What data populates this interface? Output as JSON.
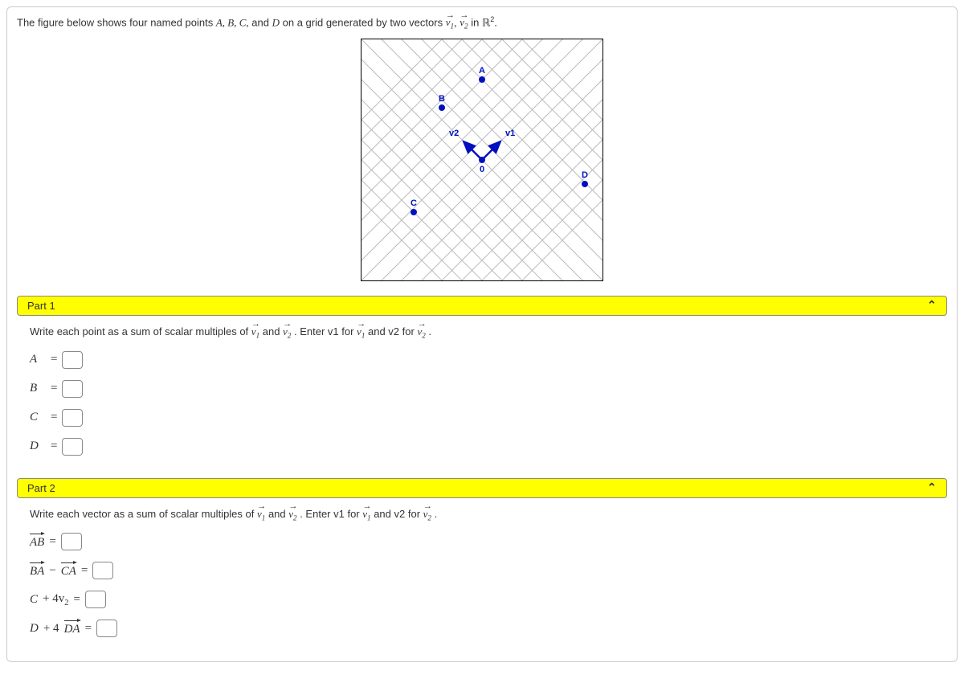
{
  "prompt": {
    "prefix": "The figure below shows four named points ",
    "pts": "A, B, C,",
    "and": " and ",
    "lastpt": "D",
    "mid": " on a grid generated by two vectors ",
    "inspace": " in ",
    "space": "ℝ",
    "exp": "2",
    "period": "."
  },
  "vecsub": {
    "one": "1",
    "two": "2"
  },
  "figure": {
    "labels": {
      "A": "A",
      "B": "B",
      "C": "C",
      "D": "D",
      "O": "0",
      "v1": "v1",
      "v2": "v2"
    }
  },
  "part1": {
    "title": "Part 1",
    "instr_pre": "Write each point as a sum of scalar multiples of ",
    "instr_mid": " and ",
    "instr_post": ". Enter v1 for ",
    "instr_post2": " and v2 for ",
    "instr_end": ".",
    "rows": {
      "A": "A",
      "B": "B",
      "C": "C",
      "D": "D"
    },
    "eq": "="
  },
  "part2": {
    "title": "Part 2",
    "instr_pre": "Write each vector as a sum of scalar multiples of ",
    "instr_mid": " and ",
    "instr_post": ". Enter v1 for ",
    "instr_post2": " and v2 for ",
    "instr_end": ".",
    "eq": "=",
    "r1": "AB",
    "r2a": "BA",
    "r2m": " − ",
    "r2b": "CA",
    "r3a": "C",
    "r3m": " + 4v",
    "r3sub": "2",
    "r4a": "D",
    "r4m": " + 4",
    "r4b": "DA"
  },
  "chart_data": {
    "type": "scatter",
    "title": "Points on a lattice generated by v1 and v2 in R^2",
    "basis_vectors": {
      "v1": [
        1,
        1
      ],
      "v2": [
        -1,
        1
      ]
    },
    "origin_label": "0",
    "points": [
      {
        "name": "A",
        "coords_v1v2": [
          3,
          3
        ]
      },
      {
        "name": "B",
        "coords_v1v2": [
          1,
          3
        ]
      },
      {
        "name": "C",
        "coords_v1v2": [
          -2,
          2
        ]
      },
      {
        "name": "D",
        "coords_v1v2": [
          1,
          -4
        ]
      }
    ],
    "grid": "diagonal lattice (45°)",
    "xlabel": "",
    "ylabel": ""
  }
}
